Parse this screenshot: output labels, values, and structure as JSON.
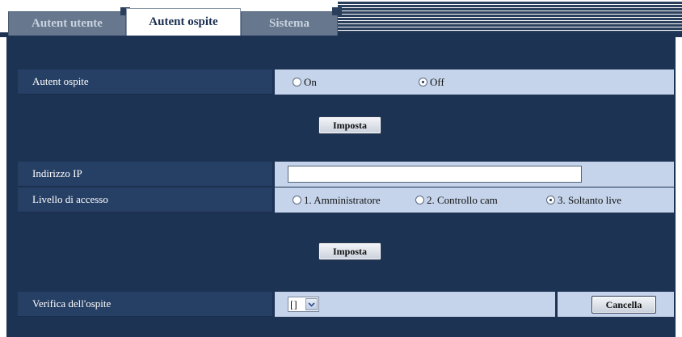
{
  "tabs": [
    {
      "label": "Autent utente",
      "active": false
    },
    {
      "label": "Autent ospite",
      "active": true
    },
    {
      "label": "Sistema",
      "active": false
    }
  ],
  "guest_auth": {
    "label": "Autent ospite",
    "options": [
      "On",
      "Off"
    ],
    "selected": "Off",
    "set_button": "Imposta"
  },
  "ip_section": {
    "ip_label": "Indirizzo IP",
    "ip_value": "",
    "access_label": "Livello di accesso",
    "access_options": [
      "1. Amministratore",
      "2. Controllo cam",
      "3. Soltanto live"
    ],
    "access_selected": "3. Soltanto live",
    "set_button": "Imposta"
  },
  "verify": {
    "label": "Verifica dell'ospite",
    "select_value": "[]",
    "cancel_button": "Cancella"
  },
  "colors": {
    "panel": "#1d3354",
    "value_bg": "#c5d4ea",
    "label_band": "#263f64"
  }
}
